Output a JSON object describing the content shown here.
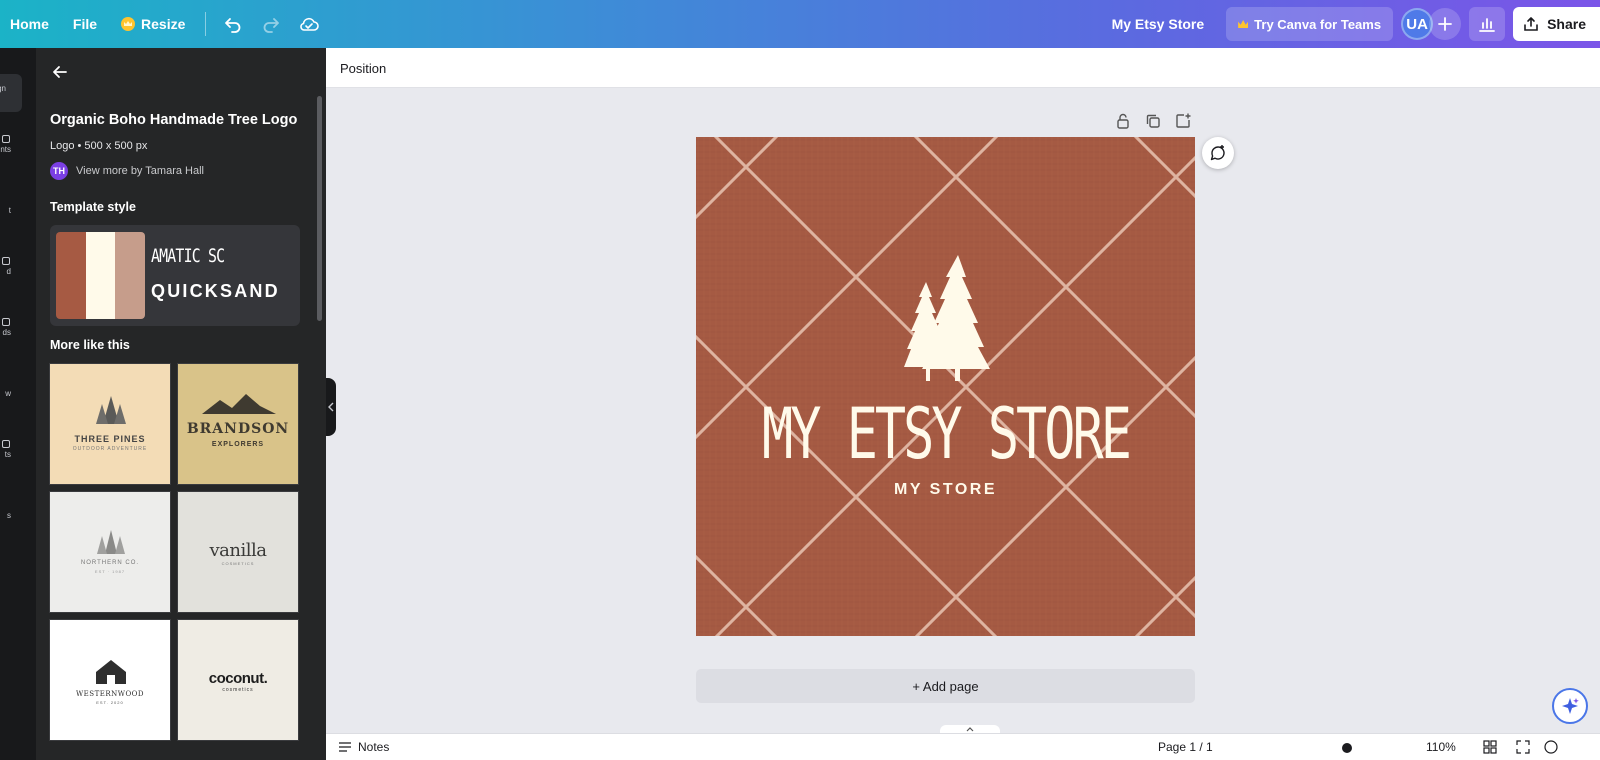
{
  "topbar": {
    "home": "Home",
    "file": "File",
    "resize": "Resize",
    "store_name": "My Etsy Store",
    "teams": "Try Canva for Teams",
    "avatar": "UA",
    "share": "Share"
  },
  "rail": {
    "items": [
      "gn",
      "nts",
      "t",
      "d",
      "ds",
      "w",
      "ts",
      "s"
    ]
  },
  "panel": {
    "title": "Organic Boho Handmade Tree Logo",
    "meta": "Logo • 500 x 500 px",
    "author_initials": "TH",
    "author": "View more by Tamara Hall",
    "style_label": "Template style",
    "font_1": "AMATIC SC",
    "font_2": "QUICKSAND",
    "swatches": [
      "#a65a43",
      "#fffaea",
      "#c69d8b"
    ],
    "more_label": "More like this",
    "thumbs": [
      {
        "title": "THREE PINES",
        "sub": "OUTDOOR ADVENTURE"
      },
      {
        "title": "BRANDSON",
        "sub": "EXPLORERS"
      },
      {
        "title": "NORTHERN CO.",
        "sub": "EST · 1987"
      },
      {
        "title": "vanilla",
        "sub": "COSMETICS"
      },
      {
        "title": "WESTERNWOOD",
        "sub": "EST. 2020"
      },
      {
        "title": "coconut.",
        "sub": "cosmetics"
      }
    ]
  },
  "editor": {
    "position": "Position",
    "add_page": "+ Add page",
    "notes": "Notes",
    "page_info": "Page 1 / 1",
    "zoom": "110%"
  },
  "design": {
    "title": "MY ETSY STORE",
    "subtitle": "MY STORE",
    "bg_color": "#a55a43",
    "text_color": "#fffaea"
  }
}
